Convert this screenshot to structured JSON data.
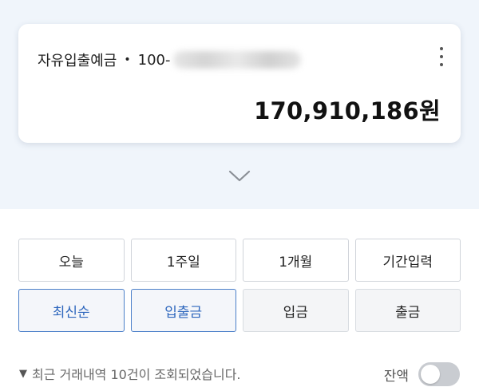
{
  "account": {
    "name": "자유입출예금",
    "separator": "•",
    "number_prefix": "100-",
    "balance": "170,910,186원"
  },
  "period_filters": [
    "오늘",
    "1주일",
    "1개월",
    "기간입력"
  ],
  "sort_filters": [
    "최신순",
    "입출금"
  ],
  "type_filters": [
    "입금",
    "출금"
  ],
  "notice": {
    "marker": "▼",
    "text": "최근 거래내역 10건이 조회되었습니다."
  },
  "balance_toggle": {
    "label": "잔액",
    "on": false
  },
  "colors": {
    "top_background": "#f0f5fb",
    "active_accent": "#2e67bd",
    "toggle_off": "#c9ccd1"
  },
  "icons": {
    "more": "more-vertical-icon",
    "expand": "chevron-down-icon"
  }
}
